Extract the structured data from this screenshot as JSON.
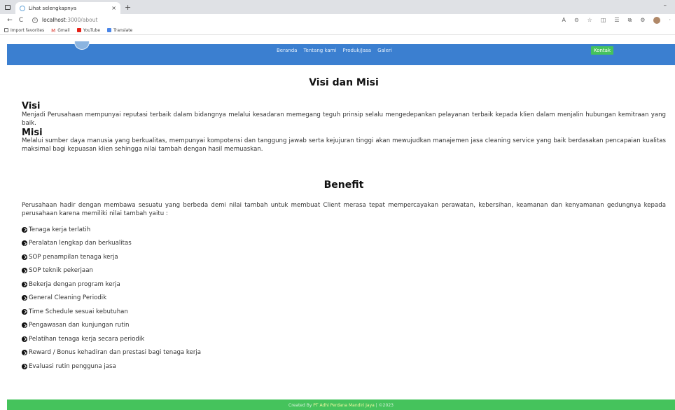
{
  "browser": {
    "tab_title": "Lihat selengkapnya",
    "tab_close": "×",
    "new_tab": "+",
    "minimize": "–",
    "nav": {
      "back": "←",
      "reload": "C"
    },
    "url_host": "localhost",
    "url_path": ":3000/about",
    "bookmarks": [
      {
        "label": "Import favorites"
      },
      {
        "label": "Gmail"
      },
      {
        "label": "YouTube"
      },
      {
        "label": "Translate"
      }
    ]
  },
  "sitenav": {
    "links": [
      "Beranda",
      "Tentang kami",
      "Produk/Jasa",
      "Galeri"
    ],
    "contact": "Kontak"
  },
  "visi_misi": {
    "title": "Visi dan Misi",
    "visi_heading": "Visi",
    "visi_text": "Menjadi Perusahaan mempunyai reputasi terbaik dalam bidangnya melalui kesadaran memegang teguh prinsip selalu mengedepankan pelayanan terbaik kepada klien dalam menjalin hubungan kemitraan yang baik.",
    "misi_heading": "Misi",
    "misi_text": "Melalui sumber daya manusia yang berkualitas, mempunyai kompotensi dan tanggung jawab serta kejujuran tinggi akan mewujudkan manajemen jasa cleaning service yang baik berdasakan pencapaian kualitas maksimal bagi kepuasan klien sehingga nilai tambah dengan hasil memuaskan."
  },
  "benefit": {
    "title": "Benefit",
    "intro": "Perusahaan hadir dengan membawa sesuatu yang berbeda demi nilai tambah untuk membuat Client merasa tepat mempercayakan perawatan, kebersihan, keamanan dan kenyamanan gedungnya kepada perusahaan karena memiliki nilai tambah yaitu :",
    "items": [
      "Tenaga kerja terlatih",
      "Peralatan lengkap dan berkualitas",
      "SOP penampilan tenaga kerja",
      "SOP teknik pekerjaan",
      "Bekerja dengan program kerja",
      "General Cleaning Periodik",
      "Time Schedule sesuai kebutuhan",
      "Pengawasan dan kunjungan rutin",
      "Pelatihan tenaga kerja secara periodik",
      "Reward / Bonus kehadiran dan prestasi bagi tenaga kerja",
      "Evaluasi rutin pengguna jasa"
    ]
  },
  "footer": {
    "prefix": "Created By ",
    "company": "PT Adhi Perdana Mandiri Jaya",
    "suffix": " | ©2023"
  },
  "colors": {
    "nav_bg": "#3b7fd0",
    "contact_bg": "#45c35c",
    "footer_bg": "#45c35c"
  }
}
